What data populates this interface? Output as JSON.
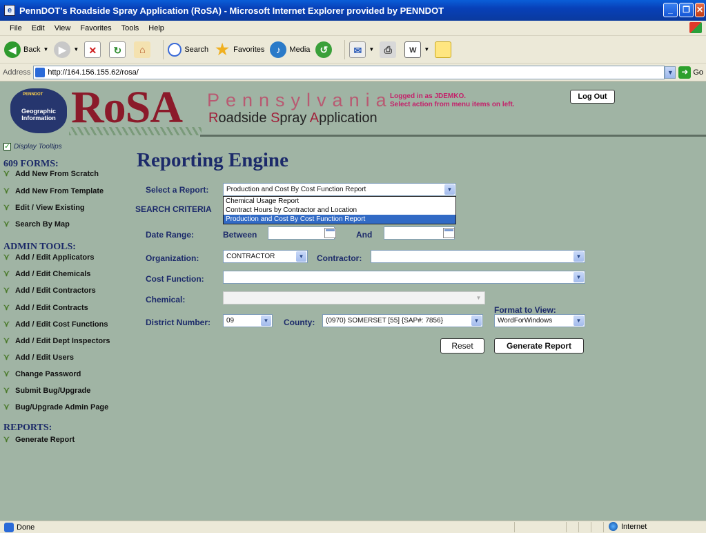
{
  "window": {
    "title": "PennDOT's Roadside Spray Application (RoSA) - Microsoft Internet Explorer provided by PENNDOT"
  },
  "menu": [
    "File",
    "Edit",
    "View",
    "Favorites",
    "Tools",
    "Help"
  ],
  "toolbar": {
    "back": "Back",
    "search": "Search",
    "favorites": "Favorites",
    "media": "Media"
  },
  "address": {
    "label": "Address",
    "url": "http://164.156.155.62/rosa/",
    "go": "Go"
  },
  "header": {
    "geo_top": "PENNDOT",
    "geo_line1": "Geographic",
    "geo_line2": "Information",
    "rosa": "RoSA",
    "pennsylvania": "Pennsylvania",
    "sub_r": "R",
    "sub_oadside": "oadside ",
    "sub_s": "S",
    "sub_pray": "pray ",
    "sub_a": "A",
    "sub_pplication": "pplication",
    "logged_in": "Logged in as JDEMKO.",
    "instruction": "Select action from menu items on left.",
    "logout": "Log Out"
  },
  "sidebar": {
    "display_tooltips": "Display Tooltips",
    "forms_heading": "609 FORMS:",
    "forms": [
      "Add New From Scratch",
      "Add New From Template",
      "Edit / View Existing",
      "Search By Map"
    ],
    "admin_heading": "ADMIN TOOLS:",
    "admin": [
      "Add / Edit Applicators",
      "Add / Edit Chemicals",
      "Add / Edit Contractors",
      "Add / Edit Contracts",
      "Add / Edit Cost Functions",
      "Add / Edit Dept Inspectors",
      "Add / Edit Users",
      "Change Password",
      "Submit Bug/Upgrade",
      "Bug/Upgrade Admin Page"
    ],
    "reports_heading": "REPORTS:",
    "reports": [
      "Generate Report"
    ]
  },
  "main": {
    "title": "Reporting Engine",
    "select_report_label": "Select a Report:",
    "select_report_value": "Production and Cost By Cost Function Report",
    "report_options": [
      "Chemical Usage Report",
      "Contract Hours by Contractor and Location",
      "Production and Cost By Cost Function Report"
    ],
    "search_criteria": "SEARCH CRITERIA",
    "date_range_label": "Date Range:",
    "between_label": "Between",
    "and_label": "And",
    "organization_label": "Organization:",
    "organization_value": "CONTRACTOR",
    "contractor_label": "Contractor:",
    "contractor_value": "",
    "cost_function_label": "Cost Function:",
    "cost_function_value": "",
    "chemical_label": "Chemical:",
    "chemical_value": "",
    "district_label": "District Number:",
    "district_value": "09",
    "county_label": "County:",
    "county_value": "(0970) SOMERSET [55] {SAP#: 7856}",
    "format_label": "Format to View:",
    "format_value": "WordForWindows",
    "reset": "Reset",
    "generate": "Generate Report"
  },
  "status": {
    "text": "Done",
    "zone": "Internet"
  }
}
